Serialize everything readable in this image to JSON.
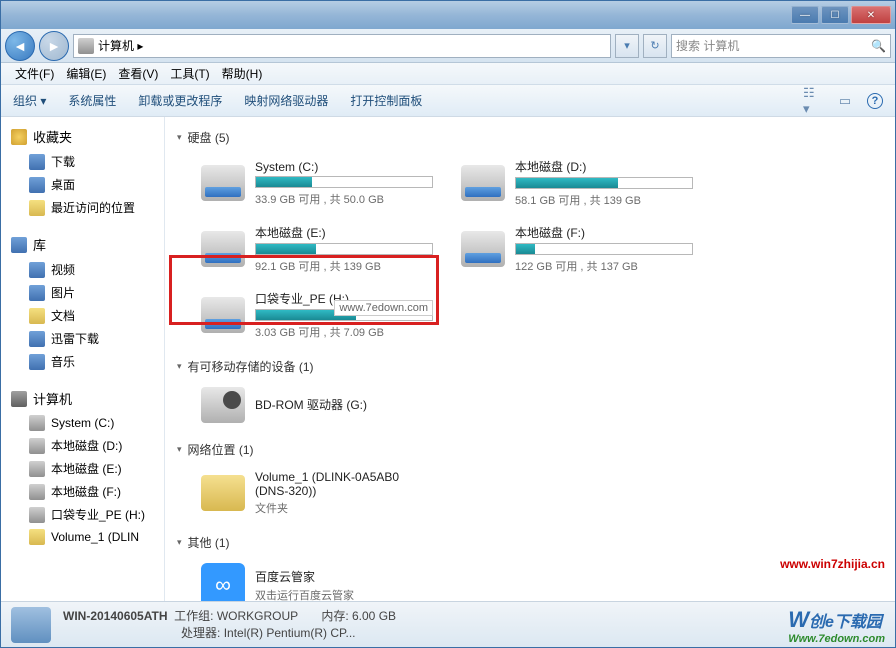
{
  "titlebar": {
    "min": "—",
    "max": "☐",
    "close": "✕"
  },
  "nav": {
    "back": "◄",
    "forward": "►",
    "breadcrumb_icon": "💻",
    "breadcrumb": "计算机 ▸",
    "refresh": "↻",
    "search_placeholder": "搜索 计算机",
    "search_icon": "🔍"
  },
  "menu": [
    "文件(F)",
    "编辑(E)",
    "查看(V)",
    "工具(T)",
    "帮助(H)"
  ],
  "toolbar": {
    "organize": "组织 ▾",
    "items": [
      "系统属性",
      "卸载或更改程序",
      "映射网络驱动器",
      "打开控制面板"
    ],
    "help": "?"
  },
  "sidebar": {
    "favorites": {
      "title": "收藏夹",
      "items": [
        "下载",
        "桌面",
        "最近访问的位置"
      ]
    },
    "libraries": {
      "title": "库",
      "items": [
        "视频",
        "图片",
        "文档",
        "迅雷下载",
        "音乐"
      ]
    },
    "computer": {
      "title": "计算机",
      "items": [
        "System (C:)",
        "本地磁盘 (D:)",
        "本地磁盘 (E:)",
        "本地磁盘 (F:)",
        "口袋专业_PE (H:)",
        "Volume_1 (DLIN"
      ]
    }
  },
  "main": {
    "hdd_header": "硬盘 (5)",
    "drives": [
      {
        "name": "System (C:)",
        "text": "33.9 GB 可用 , 共 50.0 GB",
        "fill": 32
      },
      {
        "name": "本地磁盘 (D:)",
        "text": "58.1 GB 可用 , 共 139 GB",
        "fill": 58
      },
      {
        "name": "本地磁盘 (E:)",
        "text": "92.1 GB 可用 , 共 139 GB",
        "fill": 34
      },
      {
        "name": "本地磁盘 (F:)",
        "text": "122 GB 可用 , 共 137 GB",
        "fill": 11
      },
      {
        "name": "口袋专业_PE (H:)",
        "text": "3.03 GB 可用 , 共 7.09 GB",
        "fill": 57
      }
    ],
    "annotation": "www.7edown.com",
    "removable_header": "有可移动存储的设备 (1)",
    "removable": {
      "name": "BD-ROM 驱动器 (G:)"
    },
    "network_header": "网络位置 (1)",
    "network": {
      "name": "Volume_1 (DLINK-0A5AB0 (DNS-320))",
      "sub": "文件夹"
    },
    "other_header": "其他 (1)",
    "other": {
      "name": "百度云管家",
      "sub": "双击运行百度云管家"
    },
    "watermark_a": "www.win7zhijia.cn"
  },
  "status": {
    "name": "WIN-20140605ATH",
    "workgroup_label": "工作组:",
    "workgroup": "WORKGROUP",
    "mem_label": "内存:",
    "mem": "6.00 GB",
    "cpu_label": "处理器:",
    "cpu": "Intel(R) Pentium(R) CP...",
    "logo_text": "创e下载园",
    "logo_url": "Www.7edown.com"
  }
}
